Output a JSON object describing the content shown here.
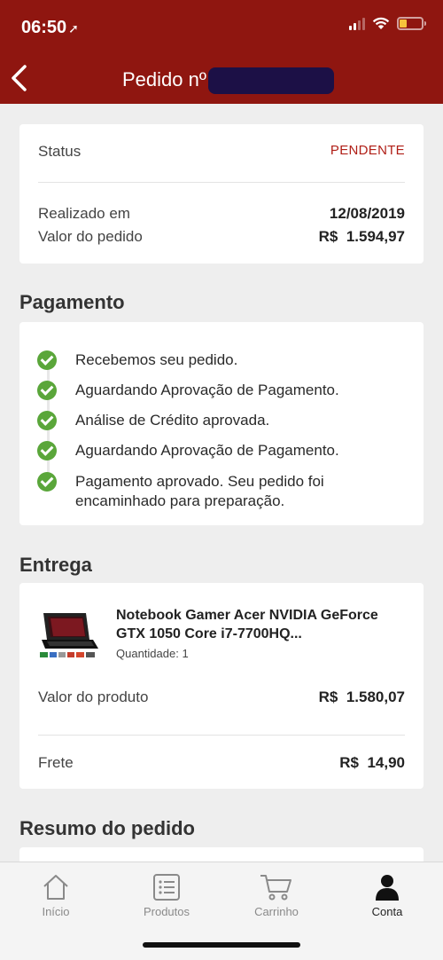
{
  "status_bar": {
    "time": "06:50",
    "location_icon": "location-arrow-icon"
  },
  "nav": {
    "title": "Pedido nº",
    "back_icon": "chevron-left-icon"
  },
  "order": {
    "status_label": "Status",
    "status_value": "PENDENTE",
    "date_label": "Realizado em",
    "date_value": "12/08/2019",
    "total_label": "Valor do pedido",
    "total_value": "R$  1.594,97"
  },
  "payment": {
    "title": "Pagamento",
    "steps": [
      "Recebemos seu pedido.",
      "Aguardando Aprovação de Pagamento.",
      "Análise de Crédito aprovada.",
      "Aguardando Aprovação de Pagamento.",
      "Pagamento aprovado. Seu pedido foi encaminhado para preparação."
    ]
  },
  "delivery": {
    "title": "Entrega",
    "product_name": "Notebook Gamer Acer NVIDIA GeForce GTX 1050 Core i7-7700HQ...",
    "quantity": "Quantidade: 1",
    "product_value_label": "Valor do produto",
    "product_value": "R$  1.580,07",
    "shipping_label": "Frete",
    "shipping_value": "R$  14,90"
  },
  "summary": {
    "title": "Resumo do pedido"
  },
  "tabbar": {
    "items": [
      {
        "label": "Início",
        "icon": "home-icon"
      },
      {
        "label": "Produtos",
        "icon": "list-icon"
      },
      {
        "label": "Carrinho",
        "icon": "cart-icon"
      },
      {
        "label": "Conta",
        "icon": "user-icon"
      }
    ],
    "active": "Conta"
  },
  "colors": {
    "brand": "#8f1610",
    "success": "#5aa63a",
    "status_pending": "#b01e16"
  }
}
